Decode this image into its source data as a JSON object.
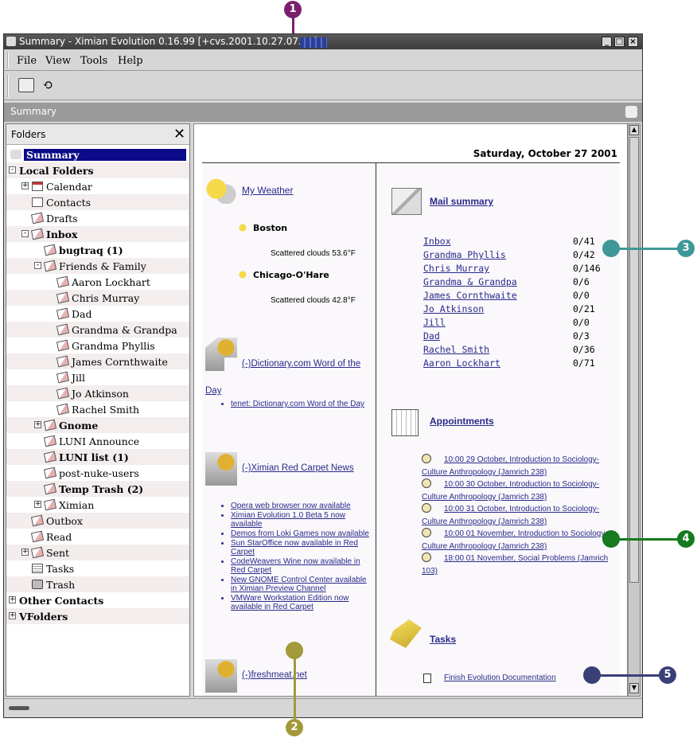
{
  "window": {
    "title": "Summary - Ximian Evolution 0.16.99 [+cvs.2001.10.27.07.57]"
  },
  "menu": [
    "File",
    "View",
    "Tools",
    "Help"
  ],
  "summary_bar": "Summary",
  "folders": {
    "header": "Folders",
    "items": [
      {
        "label": "Summary",
        "bold": true,
        "selected": true,
        "level": 0
      },
      {
        "label": "Local Folders",
        "bold": true,
        "level": 0,
        "expander": "-"
      },
      {
        "label": "Calendar",
        "level": 1,
        "expander": "+",
        "icon": "calendar"
      },
      {
        "label": "Contacts",
        "level": 1,
        "icon": "contacts"
      },
      {
        "label": "Drafts",
        "level": 1,
        "icon": "mail"
      },
      {
        "label": "Inbox",
        "bold": true,
        "level": 1,
        "expander": "-",
        "icon": "mail"
      },
      {
        "label": "bugtraq (1)",
        "bold": true,
        "level": 2,
        "icon": "mail"
      },
      {
        "label": "Friends & Family",
        "level": 2,
        "expander": "-",
        "icon": "mail"
      },
      {
        "label": "Aaron Lockhart",
        "level": 3,
        "icon": "mail"
      },
      {
        "label": "Chris Murray",
        "level": 3,
        "icon": "mail"
      },
      {
        "label": "Dad",
        "level": 3,
        "icon": "mail"
      },
      {
        "label": "Grandma & Grandpa",
        "level": 3,
        "icon": "mail"
      },
      {
        "label": "Grandma Phyllis",
        "level": 3,
        "icon": "mail"
      },
      {
        "label": "James Cornthwaite",
        "level": 3,
        "icon": "mail"
      },
      {
        "label": "Jill",
        "level": 3,
        "icon": "mail"
      },
      {
        "label": "Jo Atkinson",
        "level": 3,
        "icon": "mail"
      },
      {
        "label": "Rachel Smith",
        "level": 3,
        "icon": "mail"
      },
      {
        "label": "Gnome",
        "bold": true,
        "level": 2,
        "expander": "+",
        "icon": "mail"
      },
      {
        "label": "LUNI Announce",
        "level": 2,
        "icon": "mail"
      },
      {
        "label": "LUNI list (1)",
        "bold": true,
        "level": 2,
        "icon": "mail"
      },
      {
        "label": "post-nuke-users",
        "level": 2,
        "icon": "mail"
      },
      {
        "label": "Temp Trash (2)",
        "bold": true,
        "level": 2,
        "icon": "mail"
      },
      {
        "label": "Ximian",
        "level": 2,
        "expander": "+",
        "icon": "mail"
      },
      {
        "label": "Outbox",
        "level": 1,
        "icon": "mail"
      },
      {
        "label": "Read",
        "level": 1,
        "icon": "mail"
      },
      {
        "label": "Sent",
        "level": 1,
        "expander": "+",
        "icon": "mail"
      },
      {
        "label": "Tasks",
        "level": 1,
        "icon": "tasks"
      },
      {
        "label": "Trash",
        "level": 1,
        "icon": "trash"
      },
      {
        "label": "Other Contacts",
        "bold": true,
        "level": 0,
        "expander": "+"
      },
      {
        "label": "VFolders",
        "bold": true,
        "level": 0,
        "expander": "+"
      }
    ]
  },
  "summary": {
    "date": "Saturday, October 27 2001",
    "weather": {
      "title": "My Weather",
      "places": [
        {
          "name": "Boston",
          "desc": "Scattered clouds 53.6°F"
        },
        {
          "name": "Chicago-O'Hare",
          "desc": "Scattered clouds 42.8°F"
        }
      ]
    },
    "dict": {
      "title": "(-)Dictionary.com Word of the Day",
      "items": [
        "tenet: Dictionary.com Word of the Day"
      ]
    },
    "redcarpet": {
      "title": "(-)Ximian Red Carpet News",
      "items": [
        "Opera web browser now available",
        "Ximian Evolution 1.0 Beta 5 now available",
        "Demos from Loki Games now available",
        "Sun StarOffice now available in Red Carpet",
        "CodeWeavers Wine now available in Red Carpet",
        "New GNOME Control Center available in Ximian Preview Channel",
        "VMWare Workstation Edition now available in Red Carpet"
      ]
    },
    "freshmeat": {
      "title": "(-)freshmeat.net"
    },
    "mail": {
      "title": "Mail summary",
      "rows": [
        {
          "name": "Inbox",
          "count": "0/41"
        },
        {
          "name": "Grandma Phyllis",
          "count": "0/42"
        },
        {
          "name": "Chris Murray",
          "count": "0/146"
        },
        {
          "name": "Grandma & Grandpa",
          "count": "0/6"
        },
        {
          "name": "James Cornthwaite",
          "count": "0/0"
        },
        {
          "name": "Jo Atkinson",
          "count": "0/21"
        },
        {
          "name": "Jill",
          "count": "0/0"
        },
        {
          "name": "Dad",
          "count": "0/3"
        },
        {
          "name": "Rachel Smith",
          "count": "0/36"
        },
        {
          "name": "Aaron Lockhart",
          "count": "0/71"
        }
      ]
    },
    "appointments": {
      "title": "Appointments",
      "items": [
        "10:00 29 October, Introduction to Sociology-Culture Anthropology (Jamrich 238)",
        "10:00 30 October, Introduction to Sociology-Culture Anthropology (Jamrich 238)",
        "10:00 31 October, Introduction to Sociology-Culture Anthropology (Jamrich 238)",
        "10:00 01 November, Introduction to Sociology-Culture Anthropology (Jamrich 238)",
        "18:00 01 November, Social Problems (Jamrich 103)"
      ]
    },
    "tasks": {
      "title": "Tasks",
      "items": [
        "Finish Evolution Documentation"
      ]
    }
  },
  "callouts": [
    "1",
    "2",
    "3",
    "4",
    "5"
  ],
  "colors": {
    "c1": "#7a1f6e",
    "c2": "#a29a3a",
    "c3": "#3f9898",
    "c4": "#167a1e",
    "c5": "#3a3f78"
  }
}
